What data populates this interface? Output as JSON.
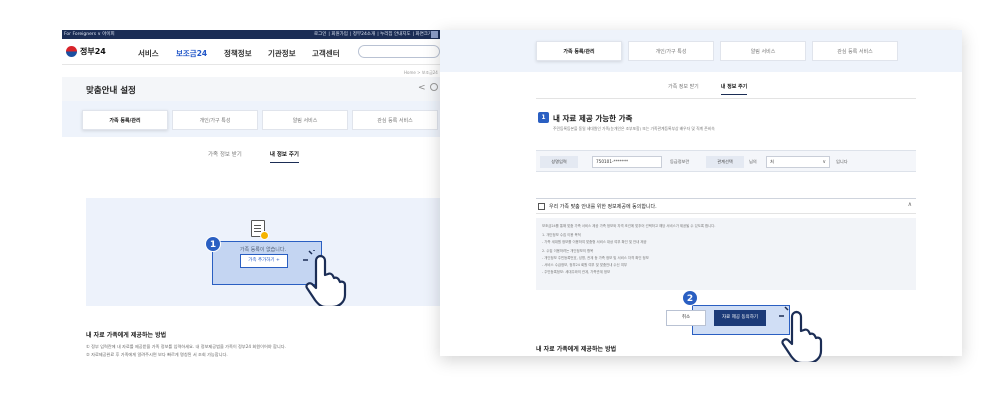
{
  "left_screen": {
    "util_left": "For Foreigners ∨   아이피",
    "util_right": [
      "로그인",
      "회원가입",
      "정부24소개",
      "누리집 안내지도",
      "화면크기"
    ],
    "logo_text": "정부24",
    "menu": [
      {
        "label": "서비스",
        "active": false
      },
      {
        "label": "보조금24",
        "active": true
      },
      {
        "label": "정책정보",
        "active": false
      },
      {
        "label": "기관정보",
        "active": false
      },
      {
        "label": "고객센터",
        "active": false
      }
    ],
    "breadcrumb": "Home > 보조금24",
    "page_title": "맞춤안내 설정",
    "tabs": [
      "가족 등록/관리",
      "개인/가구 특성",
      "알림 서비스",
      "관심 등록 서비스"
    ],
    "subtabs": [
      "가족 정보 받기",
      "내 정보 주기"
    ],
    "empty_text": "가족 등록이 없습니다.",
    "add_button": "가족 추가하기 +",
    "step": "1",
    "howto_title": "내 자료 가족에게 제공하는 방법",
    "howto_lines": [
      "① 정부 입력란에 내 자료를 제공받을 가족 정보를 입력하세요. 내 정보제공범을 가족이 정부24 회원이어야 합니다.",
      "② 자료제공완료 후 가족에게 알려주시면 보다 빠르게 명칭된 서 조회 가능합니다."
    ]
  },
  "right_screen": {
    "tabs": [
      "가족 등록/관리",
      "개인/가구 특성",
      "알림 서비스",
      "관심 등록 서비스"
    ],
    "subtabs": [
      "가족 정보 받기",
      "내 정보 주기"
    ],
    "section_number": "1",
    "section_title": "내 자료 제공 가능한 가족",
    "section_desc": "주민등록등본을 동일 세대원인 가족(눈개인은 조부포함) 또는 가족관계등록부상 배우자 및 직계 존비속",
    "form": {
      "name_label": "성명입력",
      "id_value": "750101-*******",
      "id_caption": "등급정보란",
      "relation_label": "관계선택",
      "relation_value": "처",
      "relation_suffix": "님의",
      "after_select": "입니다"
    },
    "consent_text": "우리 가족 맞춤 안내를 위한 정보제공에 동의합니다.",
    "terms_lines": [
      "보조금24를 통해 맞춤 가족 서비스 제공 가족 정보와 자격 조건에 맞추어 선택하고 해당 서비스가 제공될 수 있도록 합니다.",
      "1. 개인정보 수집 이용 목적",
      "  - 가족 세대원 정보를 이용하여 맞춤형 서비스 대상 여부 확인 및 안내 제공",
      "2. 수집 이용하려는 개인정보의 항목",
      "  - 개인정보 주민등록번호, 성명, 관계 등 가족 정보 및 서비스 자격 확인 정보",
      "  - 서비스 수급정보, 정부24 회원 여부 및 맞춤안내 수신 여부",
      "  - 주민등록정보: 세대주와의 관계, 가족관계 정보"
    ],
    "cancel_button": "취소",
    "submit_button": "자료 제공 동의하기",
    "step": "2",
    "howto_title": "내 자료 가족에게 제공하는 방법"
  },
  "colors": {
    "accent": "#2a5fc2",
    "navy": "#1b2d55",
    "highlight": "#78a0e1"
  }
}
